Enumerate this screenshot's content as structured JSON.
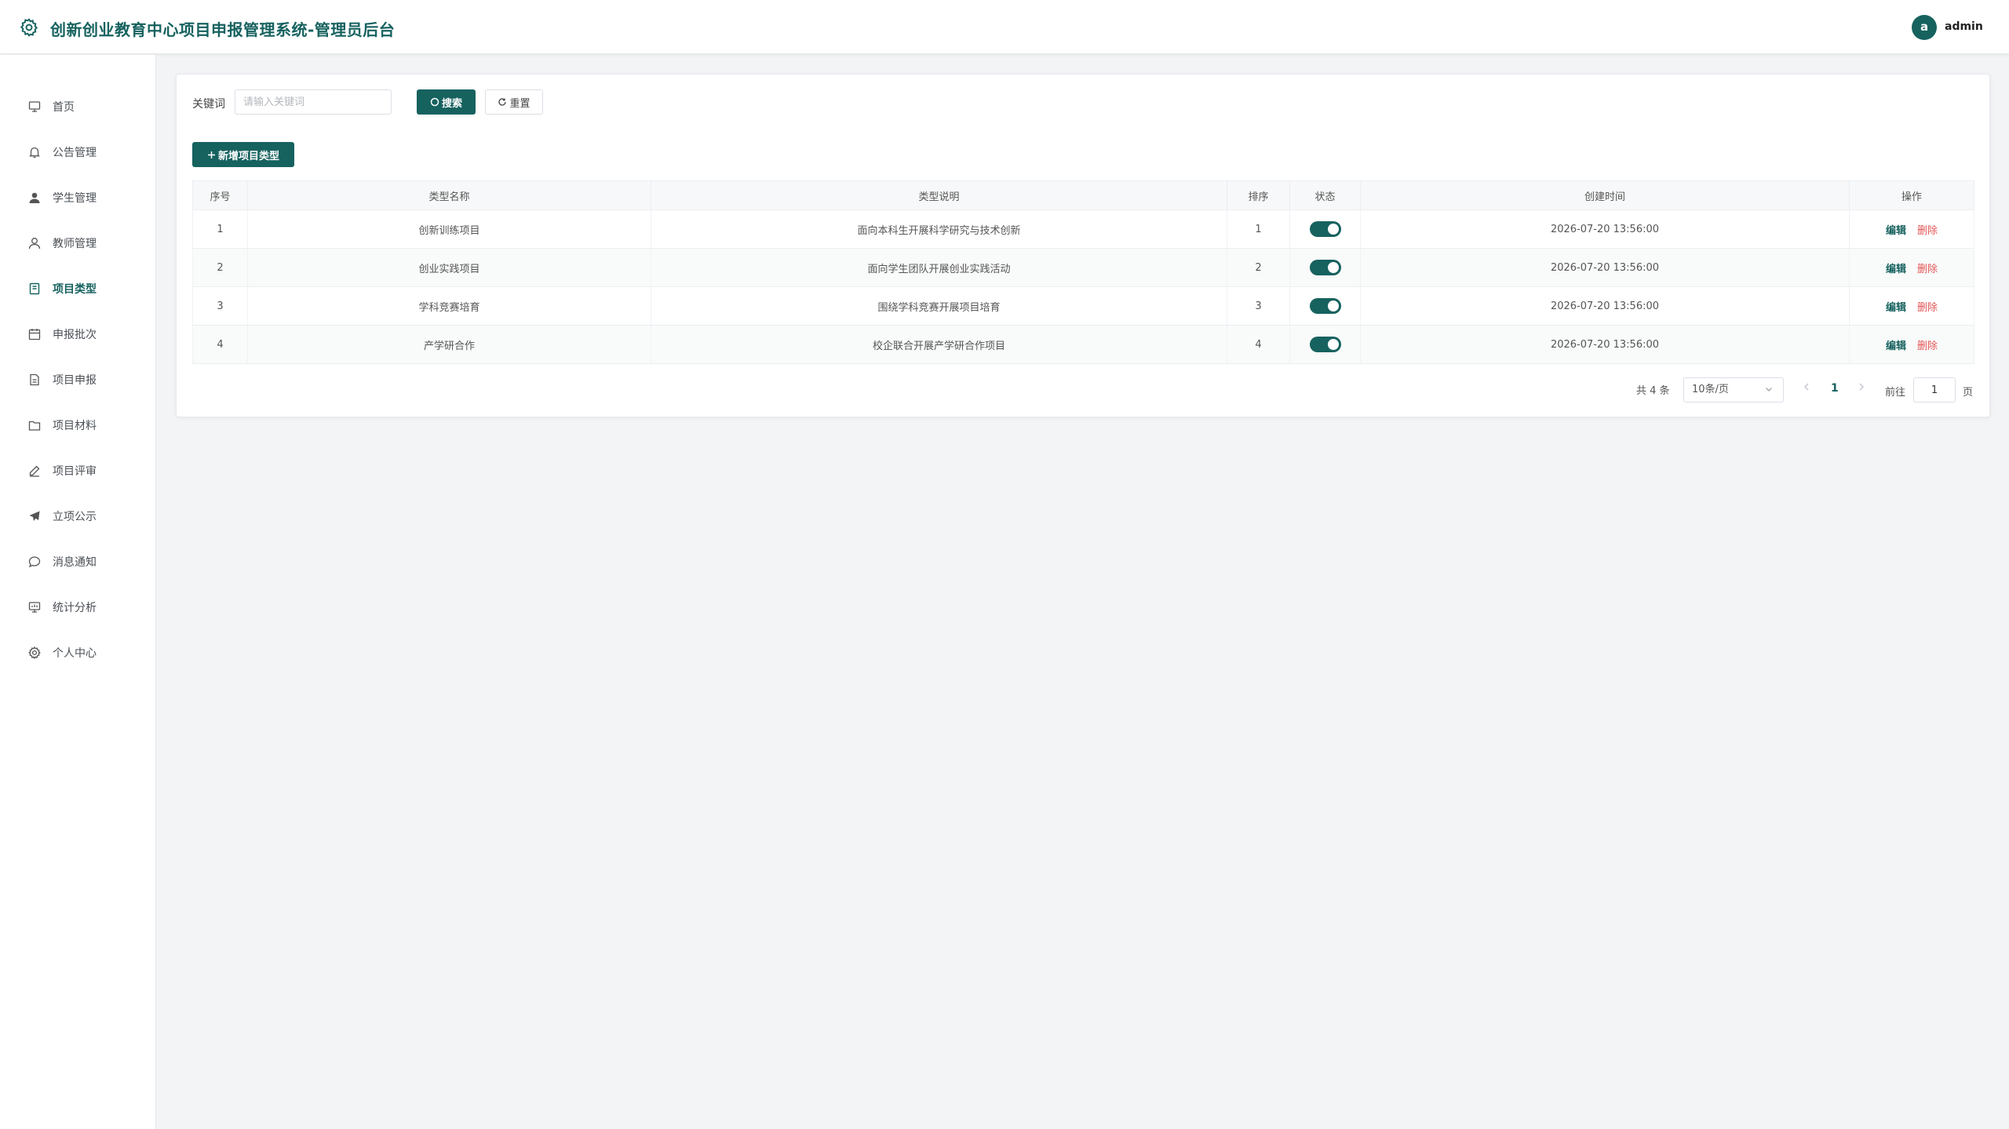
{
  "header": {
    "title": "创新创业教育中心项目申报管理系统-管理员后台",
    "avatar_letter": "a",
    "username": "admin"
  },
  "sidebar": {
    "items": [
      {
        "label": "首页",
        "icon": "monitor-icon"
      },
      {
        "label": "公告管理",
        "icon": "bell-icon"
      },
      {
        "label": "学生管理",
        "icon": "user-filled-icon"
      },
      {
        "label": "教师管理",
        "icon": "user-icon"
      },
      {
        "label": "项目类型",
        "icon": "notebook-icon",
        "active": true
      },
      {
        "label": "申报批次",
        "icon": "calendar-icon"
      },
      {
        "label": "项目申报",
        "icon": "document-icon"
      },
      {
        "label": "项目材料",
        "icon": "folder-icon"
      },
      {
        "label": "项目评审",
        "icon": "edit-pen-icon"
      },
      {
        "label": "立项公示",
        "icon": "promotion-icon"
      },
      {
        "label": "消息通知",
        "icon": "chat-icon"
      },
      {
        "label": "统计分析",
        "icon": "data-board-icon"
      },
      {
        "label": "个人中心",
        "icon": "setting-icon"
      }
    ]
  },
  "search": {
    "label": "关键词",
    "placeholder": "请输入关键词",
    "value": "",
    "search_btn": "搜索",
    "reset_btn": "重置"
  },
  "toolbar": {
    "add_btn": "新增项目类型"
  },
  "table": {
    "columns": [
      "序号",
      "类型名称",
      "类型说明",
      "排序",
      "状态",
      "创建时间",
      "操作"
    ],
    "rows": [
      {
        "index": "1",
        "name": "创新训练项目",
        "desc": "面向本科生开展科学研究与技术创新",
        "sort": "1",
        "enabled": true,
        "created": "2026-07-20 13:56:00"
      },
      {
        "index": "2",
        "name": "创业实践项目",
        "desc": "面向学生团队开展创业实践活动",
        "sort": "2",
        "enabled": true,
        "created": "2026-07-20 13:56:00"
      },
      {
        "index": "3",
        "name": "学科竞赛培育",
        "desc": "围绕学科竞赛开展项目培育",
        "sort": "3",
        "enabled": true,
        "created": "2026-07-20 13:56:00"
      },
      {
        "index": "4",
        "name": "产学研合作",
        "desc": "校企联合开展产学研合作项目",
        "sort": "4",
        "enabled": true,
        "created": "2026-07-20 13:56:00"
      }
    ],
    "edit_label": "编辑",
    "delete_label": "删除"
  },
  "pagination": {
    "total_text": "共 4 条",
    "page_size": "10条/页",
    "current_page": "1",
    "goto_label": "前往",
    "goto_value": "1",
    "goto_unit": "页"
  },
  "colors": {
    "primary": "#16625f",
    "danger": "#e45656",
    "background": "#f2f4f5"
  }
}
